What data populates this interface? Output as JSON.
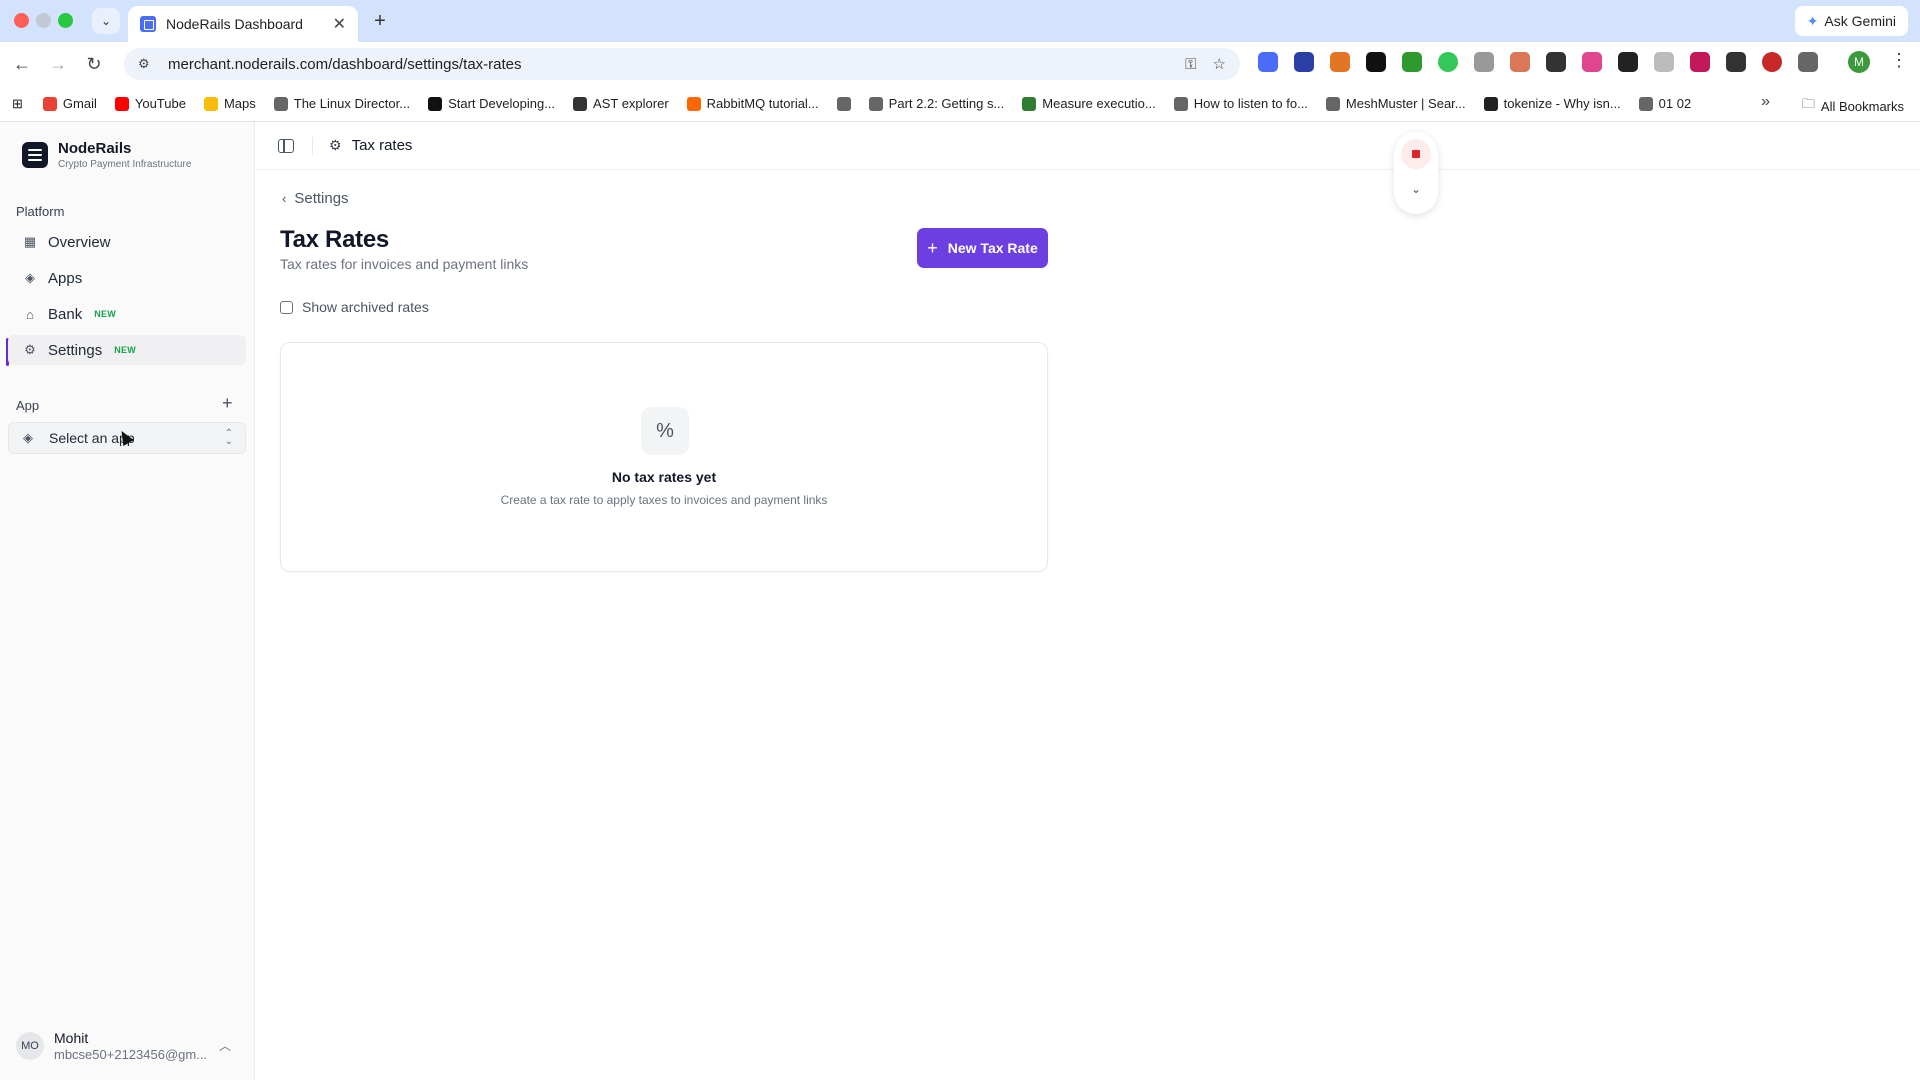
{
  "browser": {
    "tab_title": "NodeRails Dashboard",
    "tab_close": "✕",
    "new_tab": "+",
    "tab_menu": "⌄",
    "url": "merchant.noderails.com/dashboard/settings/tax-rates",
    "ask_gemini": "Ask Gemini",
    "profile_initial": "M",
    "bookmarks": [
      {
        "label": "Gmail",
        "color": "#ea4335"
      },
      {
        "label": "YouTube",
        "color": "#ff0000"
      },
      {
        "label": "Maps",
        "color": "#fbbc04"
      },
      {
        "label": "The Linux Director...",
        "color": "#666666"
      },
      {
        "label": "Start Developing...",
        "color": "#111111"
      },
      {
        "label": "AST explorer",
        "color": "#333333"
      },
      {
        "label": "RabbitMQ tutorial...",
        "color": "#ff6600"
      },
      {
        "label": "",
        "color": "#666666"
      },
      {
        "label": "Part 2.2: Getting s...",
        "color": "#666666"
      },
      {
        "label": "Measure executio...",
        "color": "#2e7d32"
      },
      {
        "label": "How to listen to fo...",
        "color": "#666666"
      },
      {
        "label": "MeshMuster | Sear...",
        "color": "#666666"
      },
      {
        "label": "tokenize - Why isn...",
        "color": "#222222"
      },
      {
        "label": "01 02",
        "color": "#666666"
      }
    ],
    "all_bookmarks": "All Bookmarks"
  },
  "sidebar": {
    "brand_name": "NodeRails",
    "brand_sub": "Crypto Payment Infrastructure",
    "platform_label": "Platform",
    "items": [
      {
        "label": "Overview",
        "icon": "grid-icon",
        "badge": ""
      },
      {
        "label": "Apps",
        "icon": "layers-icon",
        "badge": ""
      },
      {
        "label": "Bank",
        "icon": "bank-icon",
        "badge": "NEW"
      },
      {
        "label": "Settings",
        "icon": "gear-icon",
        "badge": "NEW"
      }
    ],
    "app_label": "App",
    "app_select": "Select an app",
    "user": {
      "initials": "MO",
      "name": "Mohit",
      "email": "mbcse50+2123456@gm..."
    }
  },
  "topbar": {
    "crumb": "Tax rates"
  },
  "main": {
    "back_label": "Settings",
    "title": "Tax Rates",
    "subtitle": "Tax rates for invoices and payment links",
    "new_button": "New Tax Rate",
    "show_archived": "Show archived rates",
    "empty_title": "No tax rates yet",
    "empty_sub": "Create a tax rate to apply taxes to invoices and payment links"
  },
  "colors": {
    "accent": "#6d3fe0",
    "badge": "#16a34a",
    "record": "#dc2626"
  }
}
